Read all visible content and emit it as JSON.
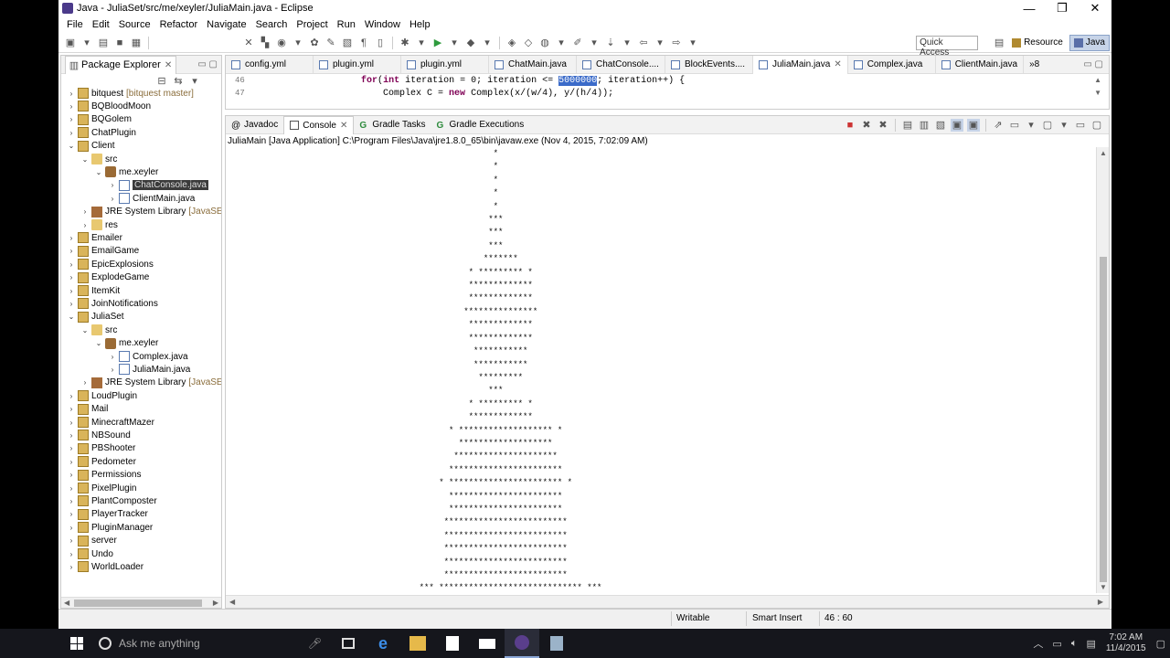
{
  "window": {
    "title": "Java - JuliaSet/src/me/xeyler/JuliaMain.java - Eclipse",
    "minimize": "—",
    "maximize": "❐",
    "close": "✕"
  },
  "menu": [
    "File",
    "Edit",
    "Source",
    "Refactor",
    "Navigate",
    "Search",
    "Project",
    "Run",
    "Window",
    "Help"
  ],
  "toolbar": {
    "quick_access_placeholder": "Quick Access",
    "perspectives": [
      "Resource",
      "Java"
    ]
  },
  "package_explorer": {
    "title": "Package Explorer",
    "tree": [
      {
        "label": "bitquest",
        "deco": "[bitquest master]",
        "depth": 0,
        "expanded": false,
        "icon": "project"
      },
      {
        "label": "BQBloodMoon",
        "depth": 0,
        "expanded": false,
        "icon": "project"
      },
      {
        "label": "BQGolem",
        "depth": 0,
        "expanded": false,
        "icon": "project"
      },
      {
        "label": "ChatPlugin",
        "depth": 0,
        "expanded": false,
        "icon": "project"
      },
      {
        "label": "Client",
        "depth": 0,
        "expanded": true,
        "icon": "project"
      },
      {
        "label": "src",
        "depth": 1,
        "expanded": true,
        "icon": "folder"
      },
      {
        "label": "me.xeyler",
        "depth": 2,
        "expanded": true,
        "icon": "pkg"
      },
      {
        "label": "ChatConsole.java",
        "depth": 3,
        "expanded": false,
        "icon": "file",
        "selected": true
      },
      {
        "label": "ClientMain.java",
        "depth": 3,
        "expanded": false,
        "icon": "file"
      },
      {
        "label": "JRE System Library",
        "deco": "[JavaSE-1.8]",
        "depth": 1,
        "expanded": false,
        "icon": "lib"
      },
      {
        "label": "res",
        "depth": 1,
        "expanded": false,
        "icon": "folder"
      },
      {
        "label": "Emailer",
        "depth": 0,
        "expanded": false,
        "icon": "project"
      },
      {
        "label": "EmailGame",
        "depth": 0,
        "expanded": false,
        "icon": "project"
      },
      {
        "label": "EpicExplosions",
        "depth": 0,
        "expanded": false,
        "icon": "project"
      },
      {
        "label": "ExplodeGame",
        "depth": 0,
        "expanded": false,
        "icon": "project"
      },
      {
        "label": "ItemKit",
        "depth": 0,
        "expanded": false,
        "icon": "project"
      },
      {
        "label": "JoinNotifications",
        "depth": 0,
        "expanded": false,
        "icon": "project"
      },
      {
        "label": "JuliaSet",
        "depth": 0,
        "expanded": true,
        "icon": "project"
      },
      {
        "label": "src",
        "depth": 1,
        "expanded": true,
        "icon": "folder"
      },
      {
        "label": "me.xeyler",
        "depth": 2,
        "expanded": true,
        "icon": "pkg"
      },
      {
        "label": "Complex.java",
        "depth": 3,
        "expanded": false,
        "icon": "file"
      },
      {
        "label": "JuliaMain.java",
        "depth": 3,
        "expanded": false,
        "icon": "file"
      },
      {
        "label": "JRE System Library",
        "deco": "[JavaSE-1.8]",
        "depth": 1,
        "expanded": false,
        "icon": "lib"
      },
      {
        "label": "LoudPlugin",
        "depth": 0,
        "expanded": false,
        "icon": "project"
      },
      {
        "label": "Mail",
        "depth": 0,
        "expanded": false,
        "icon": "project"
      },
      {
        "label": "MinecraftMazer",
        "depth": 0,
        "expanded": false,
        "icon": "project"
      },
      {
        "label": "NBSound",
        "depth": 0,
        "expanded": false,
        "icon": "project"
      },
      {
        "label": "PBShooter",
        "depth": 0,
        "expanded": false,
        "icon": "project"
      },
      {
        "label": "Pedometer",
        "depth": 0,
        "expanded": false,
        "icon": "project"
      },
      {
        "label": "Permissions",
        "depth": 0,
        "expanded": false,
        "icon": "project"
      },
      {
        "label": "PixelPlugin",
        "depth": 0,
        "expanded": false,
        "icon": "project"
      },
      {
        "label": "PlantComposter",
        "depth": 0,
        "expanded": false,
        "icon": "project"
      },
      {
        "label": "PlayerTracker",
        "depth": 0,
        "expanded": false,
        "icon": "project"
      },
      {
        "label": "PluginManager",
        "depth": 0,
        "expanded": false,
        "icon": "project"
      },
      {
        "label": "server",
        "depth": 0,
        "expanded": false,
        "icon": "project"
      },
      {
        "label": "Undo",
        "depth": 0,
        "expanded": false,
        "icon": "project"
      },
      {
        "label": "WorldLoader",
        "depth": 0,
        "expanded": false,
        "icon": "project"
      }
    ]
  },
  "editor": {
    "tabs": [
      {
        "label": "config.yml",
        "active": false
      },
      {
        "label": "plugin.yml",
        "active": false
      },
      {
        "label": "plugin.yml",
        "active": false
      },
      {
        "label": "ChatMain.java",
        "active": false
      },
      {
        "label": "ChatConsole....",
        "active": false
      },
      {
        "label": "BlockEvents....",
        "active": false
      },
      {
        "label": "JuliaMain.java",
        "active": true
      },
      {
        "label": "Complex.java",
        "active": false
      },
      {
        "label": "ClientMain.java",
        "active": false
      }
    ],
    "overflow": "»8",
    "lines": [
      {
        "num": "46",
        "indent": "                    ",
        "kw": "for",
        "pre": "(",
        "kw2": "int",
        "mid": " iteration = 0; iteration <= ",
        "highlight": "5000000",
        "post": "; iteration++) {"
      },
      {
        "num": "47",
        "indent": "                        ",
        "kw": "",
        "pre": "Complex C = ",
        "kw2": "new",
        "mid": " Complex(x/(w/4), y/(h/4));",
        "highlight": "",
        "post": ""
      }
    ]
  },
  "console": {
    "tabs": [
      {
        "label": "Javadoc",
        "active": false
      },
      {
        "label": "Console",
        "active": true
      },
      {
        "label": "Gradle Tasks",
        "active": false
      },
      {
        "label": "Gradle Executions",
        "active": false
      }
    ],
    "header": "JuliaMain [Java Application] C:\\Program Files\\Java\\jre1.8.0_65\\bin\\javaw.exe (Nov 4, 2015, 7:02:09 AM)",
    "output": [
      "                   *",
      "                   *",
      "                   *",
      "                   *",
      "                   *",
      "                  ***",
      "                  ***",
      "                  ***",
      "                 *******",
      "              * ********* *",
      "              *************",
      "              *************",
      "             ***************",
      "              *************",
      "              *************",
      "               ***********",
      "               ***********",
      "                *********",
      "                  ***",
      "              * ********* *",
      "              *************",
      "          * ******************* *",
      "            *******************",
      "           *********************",
      "          ***********************",
      "        * *********************** *",
      "          ***********************",
      "          ***********************",
      "         *************************",
      "         *************************",
      "         *************************",
      "         *************************",
      "         *************************",
      "    *** ***************************** ***"
    ]
  },
  "statusbar": {
    "mode": "Writable",
    "insert": "Smart Insert",
    "position": "46 : 60"
  },
  "taskbar": {
    "search_placeholder": "Ask me anything",
    "time": "7:02 AM",
    "date": "11/4/2015"
  }
}
